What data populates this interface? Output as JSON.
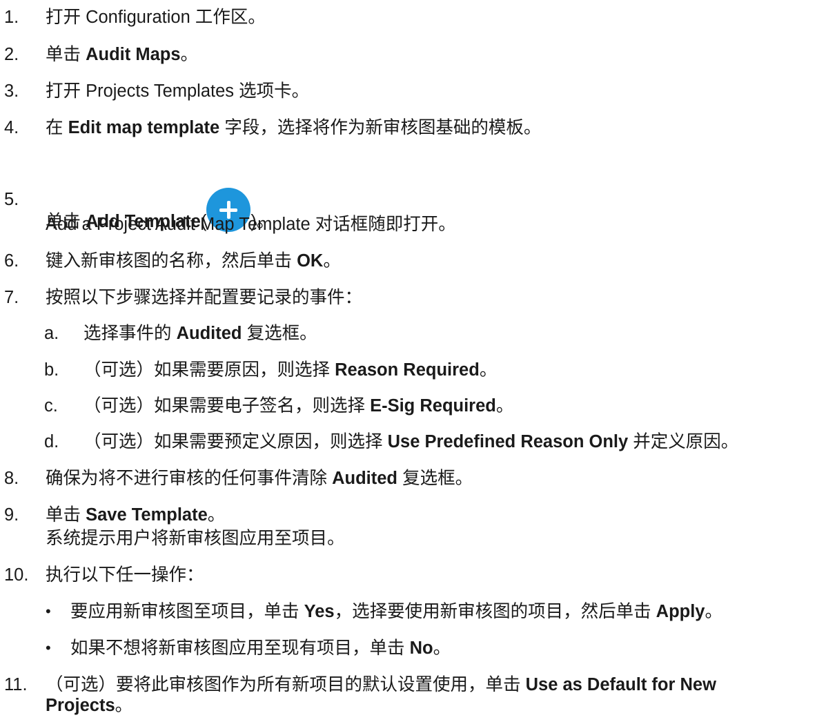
{
  "steps": [
    {
      "num": "1.",
      "pre": "打开 Configuration 工作区。"
    },
    {
      "num": "2.",
      "pre": "单击 ",
      "bold": "Audit Maps",
      "post": "。"
    },
    {
      "num": "3.",
      "pre": "打开 Projects Templates 选项卡。"
    },
    {
      "num": "4.",
      "pre": "在 ",
      "bold": "Edit map template",
      "post": " 字段，选择将作为新审核图基础的模板。"
    },
    {
      "num": "5.",
      "pre": "单击 ",
      "bold": "Add Template",
      "open": "(",
      "close": ")。",
      "icon": "plus-circle-icon",
      "line2": "Add a Project Audit Map Template 对话框随即打开。"
    },
    {
      "num": "6.",
      "pre": "键入新审核图的名称，然后单击 ",
      "bold": "OK",
      "post": "。"
    },
    {
      "num": "7.",
      "pre": "按照以下步骤选择并配置要记录的事件："
    },
    {
      "num": "8.",
      "pre": "确保为将不进行审核的任何事件清除 ",
      "bold": "Audited",
      "post": " 复选框。"
    },
    {
      "num": "9.",
      "pre": "单击 ",
      "bold": "Save Template",
      "post": "。",
      "line2": "系统提示用户将新审核图应用至项目。"
    },
    {
      "num": "10.",
      "pre": "执行以下任一操作："
    },
    {
      "num": "11.",
      "pre": "（可选）要将此审核图作为所有新项目的默认设置使用，单击 ",
      "bold": "Use as Default for New",
      "bold2": "Projects",
      "post": "。"
    }
  ],
  "substeps": [
    {
      "num": "a.",
      "pre": "选择事件的 ",
      "bold": "Audited",
      "post": " 复选框。"
    },
    {
      "num": "b.",
      "pre": "（可选）如果需要原因，则选择 ",
      "bold": "Reason Required",
      "post": "。"
    },
    {
      "num": "c.",
      "pre": "（可选）如果需要电子签名，则选择 ",
      "bold": "E-Sig Required",
      "post": "。"
    },
    {
      "num": "d.",
      "pre": "（可选）如果需要预定义原因，则选择 ",
      "bold": "Use Predefined Reason Only",
      "post": " 并定义原因。"
    }
  ],
  "bullets": [
    {
      "mark": "•",
      "pre": "要应用新审核图至项目，单击 ",
      "bold": "Yes",
      "mid": "，选择要使用新审核图的项目，然后单击 ",
      "bold2": "Apply",
      "post": "。"
    },
    {
      "mark": "•",
      "pre": "如果不想将新审核图应用至现有项目，单击 ",
      "bold": "No",
      "post": "。"
    }
  ]
}
